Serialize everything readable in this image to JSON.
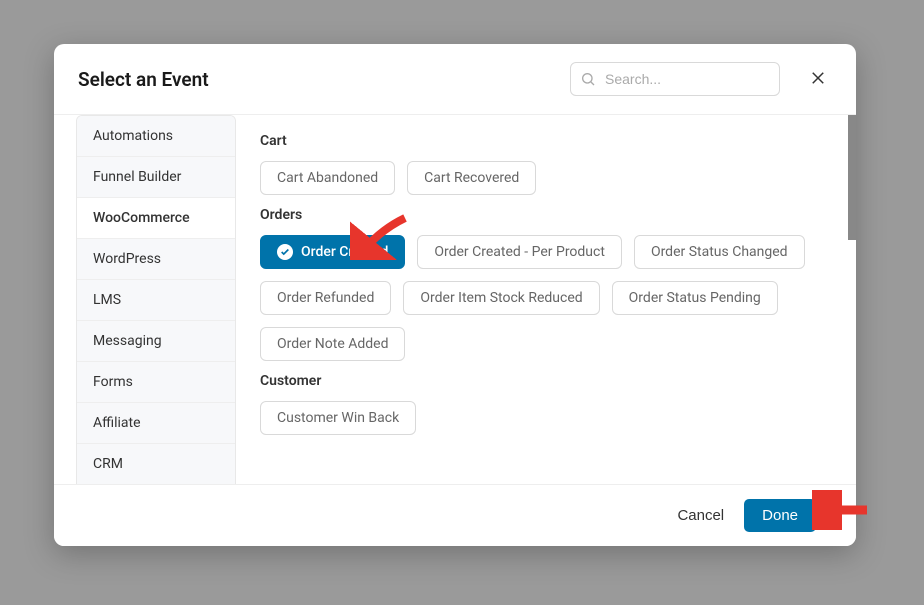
{
  "modal": {
    "title": "Select an Event",
    "search_placeholder": "Search...",
    "cancel_label": "Cancel",
    "done_label": "Done"
  },
  "sidebar": {
    "items": [
      {
        "label": "Automations",
        "active": false
      },
      {
        "label": "Funnel Builder",
        "active": false
      },
      {
        "label": "WooCommerce",
        "active": true
      },
      {
        "label": "WordPress",
        "active": false
      },
      {
        "label": "LMS",
        "active": false
      },
      {
        "label": "Messaging",
        "active": false
      },
      {
        "label": "Forms",
        "active": false
      },
      {
        "label": "Affiliate",
        "active": false
      },
      {
        "label": "CRM",
        "active": false
      }
    ]
  },
  "sections": [
    {
      "label": "Cart",
      "chips": [
        {
          "label": "Cart Abandoned",
          "selected": false
        },
        {
          "label": "Cart Recovered",
          "selected": false
        }
      ]
    },
    {
      "label": "Orders",
      "chips": [
        {
          "label": "Order Created",
          "selected": true
        },
        {
          "label": "Order Created - Per Product",
          "selected": false
        },
        {
          "label": "Order Status Changed",
          "selected": false
        },
        {
          "label": "Order Refunded",
          "selected": false
        },
        {
          "label": "Order Item Stock Reduced",
          "selected": false
        },
        {
          "label": "Order Status Pending",
          "selected": false
        },
        {
          "label": "Order Note Added",
          "selected": false
        }
      ]
    },
    {
      "label": "Customer",
      "chips": [
        {
          "label": "Customer Win Back",
          "selected": false
        }
      ]
    }
  ],
  "colors": {
    "accent": "#0073aa",
    "arrow": "#e7352c"
  }
}
